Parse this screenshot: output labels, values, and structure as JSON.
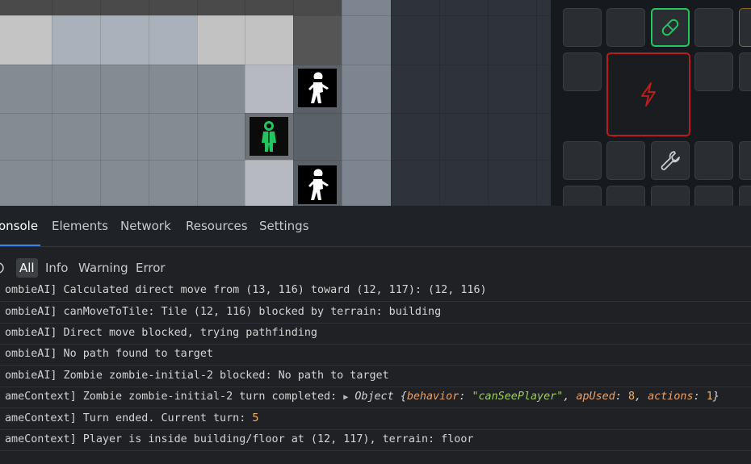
{
  "devtools": {
    "tabs": [
      {
        "label": "onsole",
        "active": true
      },
      {
        "label": "Elements"
      },
      {
        "label": "Network"
      },
      {
        "label": "Resources"
      },
      {
        "label": "Settings"
      }
    ],
    "filters": [
      {
        "label": "All",
        "active": true
      },
      {
        "label": "Info"
      },
      {
        "label": "Warning"
      },
      {
        "label": "Error"
      }
    ],
    "logs": [
      {
        "text": "ombieAI] Calculated direct move from (13, 116) toward (12, 117): (12, 116)"
      },
      {
        "text": "ombieAI] canMoveToTile: Tile (12, 116) blocked by terrain: building"
      },
      {
        "text": "ombieAI] Direct move blocked, trying pathfinding"
      },
      {
        "text": "ombieAI] No path found to target"
      },
      {
        "text": "ombieAI] Zombie zombie-initial-2 blocked: No path to target"
      },
      {
        "prefix": "ameContext] Zombie zombie-initial-2 turn completed: ",
        "object_label": "Object",
        "k1": "behavior",
        "v1": "\"canSeePlayer\"",
        "k2": "apUsed",
        "v2": "8",
        "k3": "actions",
        "v3": "1"
      },
      {
        "prefix": "ameContext] Turn ended. Current turn: ",
        "value": "5"
      },
      {
        "text": "ameContext] Player is inside building/floor at (12, 117), terrain: floor"
      }
    ]
  },
  "game": {
    "entities": [
      {
        "type": "zombie",
        "icon": "zombie-icon"
      },
      {
        "type": "player",
        "icon": "player-icon",
        "color": "#22c55e"
      },
      {
        "type": "zombie",
        "icon": "zombie-icon"
      }
    ]
  },
  "inventory": {
    "slots": [
      {
        "icon": "pill-icon",
        "selected": true,
        "accent": "#22c55e"
      },
      {
        "icon": "lightning-icon",
        "selected": true,
        "accent": "#b91c1c"
      },
      {
        "icon": "wrench-icon"
      }
    ]
  },
  "colors": {
    "accent": "#3b82f6",
    "player": "#22c55e",
    "danger": "#b91c1c"
  }
}
